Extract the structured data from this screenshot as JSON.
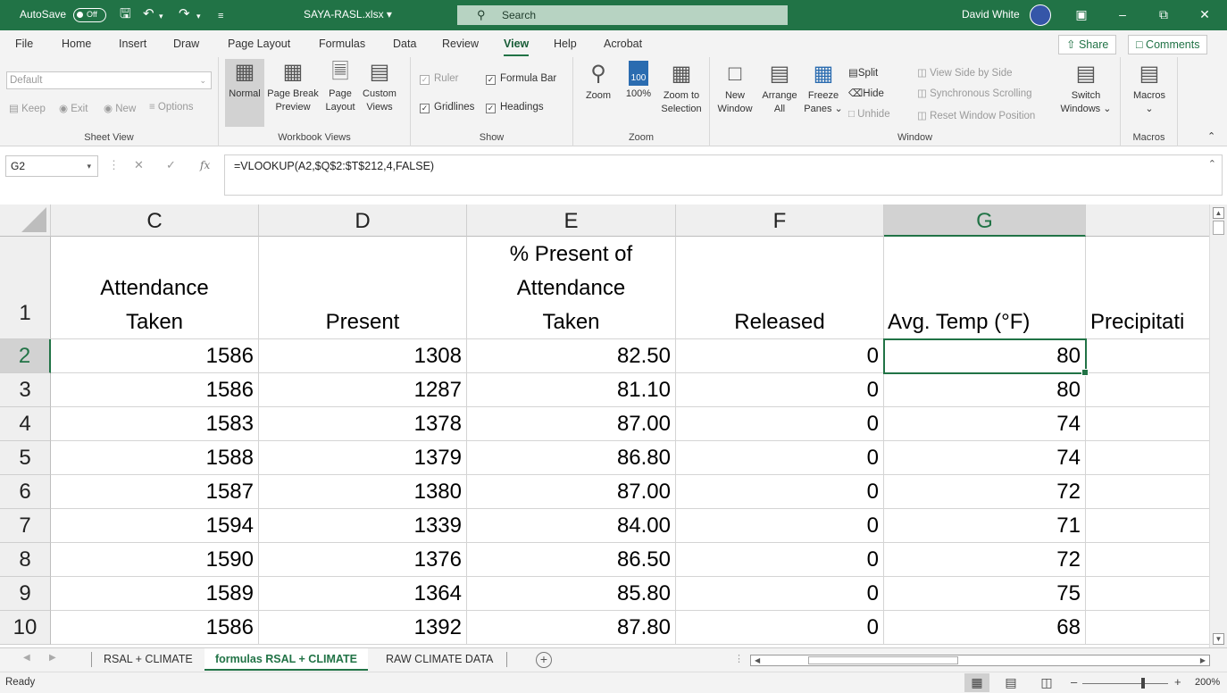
{
  "titlebar": {
    "autosave_label": "AutoSave",
    "autosave_state": "Off",
    "filename": "SAYA-RASL.xlsx",
    "search_placeholder": "Search",
    "user_name": "David White"
  },
  "menu": {
    "items": [
      "File",
      "Home",
      "Insert",
      "Draw",
      "Page Layout",
      "Formulas",
      "Data",
      "Review",
      "View",
      "Help",
      "Acrobat"
    ],
    "active": "View",
    "share_label": "Share",
    "comments_label": "Comments"
  },
  "ribbon": {
    "sheet_view": {
      "dropdown_value": "Default",
      "keep": "Keep",
      "exit": "Exit",
      "new": "New",
      "options": "Options",
      "label": "Sheet View"
    },
    "workbook_views": {
      "normal": "Normal",
      "page_break_1": "Page Break",
      "page_break_2": "Preview",
      "page_layout_1": "Page",
      "page_layout_2": "Layout",
      "custom_1": "Custom",
      "custom_2": "Views",
      "label": "Workbook Views"
    },
    "show": {
      "ruler": "Ruler",
      "formula_bar": "Formula Bar",
      "gridlines": "Gridlines",
      "headings": "Headings",
      "label": "Show"
    },
    "zoom": {
      "zoom": "Zoom",
      "hundred": "100%",
      "hundred_icon_text": "100",
      "zoom_sel_1": "Zoom to",
      "zoom_sel_2": "Selection",
      "label": "Zoom"
    },
    "window": {
      "new_1": "New",
      "new_2": "Window",
      "arrange_1": "Arrange",
      "arrange_2": "All",
      "freeze_1": "Freeze",
      "freeze_2": "Panes",
      "split": "Split",
      "hide": "Hide",
      "unhide": "Unhide",
      "side_by_side": "View Side by Side",
      "sync_scroll": "Synchronous Scrolling",
      "reset_pos": "Reset Window Position",
      "switch_1": "Switch",
      "switch_2": "Windows",
      "label": "Window"
    },
    "macros": {
      "macros": "Macros",
      "label": "Macros"
    }
  },
  "formula_bar": {
    "name_box": "G2",
    "fx_label": "fx",
    "formula": "=VLOOKUP(A2,$Q$2:$T$212,4,FALSE)"
  },
  "grid": {
    "columns": [
      "C",
      "D",
      "E",
      "F",
      "G"
    ],
    "selected_column": "G",
    "header_row": {
      "row_num": "1",
      "C": [
        "Attendance",
        "Taken"
      ],
      "D": "Present",
      "E": [
        "% Present of",
        "Attendance",
        "Taken"
      ],
      "F": "Released",
      "G": "Avg. Temp (°F)",
      "H": "Precipitati"
    },
    "rows": [
      {
        "row": "2",
        "C": "1586",
        "D": "1308",
        "E": "82.50",
        "F": "0",
        "G": "80"
      },
      {
        "row": "3",
        "C": "1586",
        "D": "1287",
        "E": "81.10",
        "F": "0",
        "G": "80"
      },
      {
        "row": "4",
        "C": "1583",
        "D": "1378",
        "E": "87.00",
        "F": "0",
        "G": "74"
      },
      {
        "row": "5",
        "C": "1588",
        "D": "1379",
        "E": "86.80",
        "F": "0",
        "G": "74"
      },
      {
        "row": "6",
        "C": "1587",
        "D": "1380",
        "E": "87.00",
        "F": "0",
        "G": "72"
      },
      {
        "row": "7",
        "C": "1594",
        "D": "1339",
        "E": "84.00",
        "F": "0",
        "G": "71"
      },
      {
        "row": "8",
        "C": "1590",
        "D": "1376",
        "E": "86.50",
        "F": "0",
        "G": "72"
      },
      {
        "row": "9",
        "C": "1589",
        "D": "1364",
        "E": "85.80",
        "F": "0",
        "G": "75"
      },
      {
        "row": "10",
        "C": "1586",
        "D": "1392",
        "E": "87.80",
        "F": "0",
        "G": "68"
      }
    ]
  },
  "sheet_tabs": {
    "tabs": [
      "RSAL + CLIMATE",
      "formulas RSAL + CLIMATE",
      "RAW CLIMATE DATA"
    ],
    "active": "formulas RSAL + CLIMATE"
  },
  "status": {
    "ready": "Ready",
    "zoom": "200%"
  },
  "colors": {
    "accent": "#217346",
    "title_bg": "#217346",
    "ribbon_bg": "#f3f3f3"
  }
}
